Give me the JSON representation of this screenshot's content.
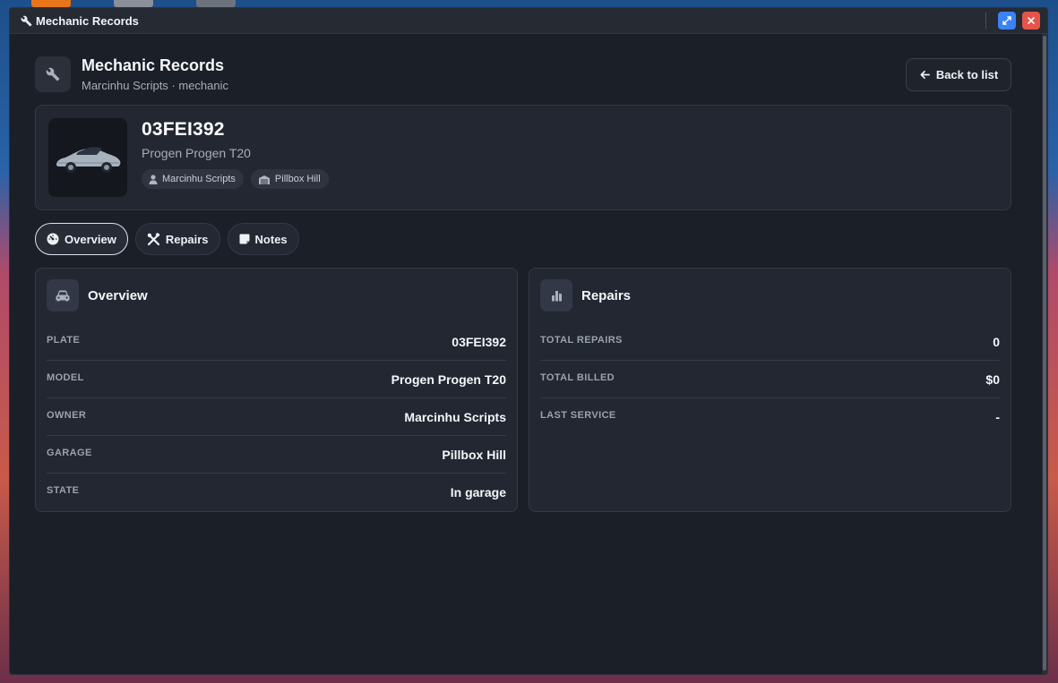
{
  "window": {
    "title": "Mechanic Records",
    "icon": "wrench-icon"
  },
  "header": {
    "title": "Mechanic Records",
    "subtitle": "Marcinhu Scripts · mechanic",
    "back_label": "Back to list"
  },
  "vehicle": {
    "plate": "03FEI392",
    "model": "Progen Progen T20",
    "owner_chip": "Marcinhu Scripts",
    "garage_chip": "Pillbox Hill"
  },
  "tabs": [
    {
      "label": "Overview",
      "active": true,
      "icon": "dashboard-icon"
    },
    {
      "label": "Repairs",
      "active": false,
      "icon": "tools-icon"
    },
    {
      "label": "Notes",
      "active": false,
      "icon": "note-icon"
    }
  ],
  "overview": {
    "title": "Overview",
    "rows": [
      {
        "label": "PLATE",
        "value": "03FEI392"
      },
      {
        "label": "MODEL",
        "value": "Progen Progen T20"
      },
      {
        "label": "OWNER",
        "value": "Marcinhu Scripts"
      },
      {
        "label": "GARAGE",
        "value": "Pillbox Hill"
      },
      {
        "label": "STATE",
        "value": "In garage"
      }
    ]
  },
  "repairs": {
    "title": "Repairs",
    "rows": [
      {
        "label": "TOTAL REPAIRS",
        "value": "0"
      },
      {
        "label": "TOTAL BILLED",
        "value": "$0"
      },
      {
        "label": "LAST SERVICE",
        "value": "-"
      }
    ]
  },
  "colors": {
    "background": "#1b1f27",
    "card": "#222731",
    "accent_blue": "#3b82f6",
    "close_red": "#e5534b"
  }
}
